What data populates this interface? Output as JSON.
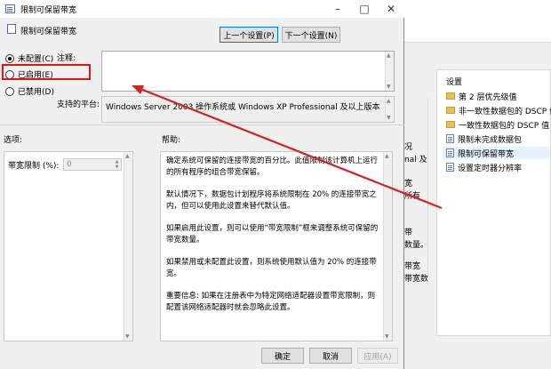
{
  "dialog": {
    "title": "限制可保留带宽",
    "header_label": "限制可保留带宽",
    "prev_button": "上一个设置(P)",
    "next_button": "下一个设置(N)",
    "radio_not_configured": "未配置(C)",
    "radio_enabled": "已启用(E)",
    "radio_disabled": "已禁用(D)",
    "comment_label": "注释:",
    "supported_label": "支持的平台:",
    "supported_value": "Windows Server 2003 操作系统或 Windows XP Professional 及以上版本",
    "options_label": "选项:",
    "help_label": "帮助:",
    "bandwidth_label": "带宽限制 (%):",
    "bandwidth_value": "0",
    "help_paragraphs": [
      "确定系统可保留的连接带宽的百分比。此值限制该计算机上运行的所有程序的组合带宽保留。",
      "默认情况下，数据包计划程序将系统限制在 20% 的连接带宽之内，但可以使用此设置来替代默认值。",
      "如果启用此设置，则可以使用“带宽限制”框来调整系统可保留的带宽数量。",
      "如果禁用或未配置此设置，则系统使用默认值为 20% 的连接带宽。",
      "重要信息: 如果在注册表中为特定网络适配器设置带宽限制，则配置该网络适配器时就会忽略此设置。"
    ],
    "ok_button": "确定",
    "cancel_button": "取消",
    "apply_button": "应用(A)"
  },
  "background": {
    "panel_header": "设置",
    "items": [
      {
        "icon": "folder-icon",
        "label": "第 2 层优先级值"
      },
      {
        "icon": "folder-icon",
        "label": "非一致性数据包的 DSCP 值"
      },
      {
        "icon": "folder-icon",
        "label": "一致性数据包的 DSCP 值"
      },
      {
        "icon": "policy-icon",
        "label": "限制未完成数据包"
      },
      {
        "icon": "policy-icon",
        "label": "限制可保留带宽"
      },
      {
        "icon": "policy-icon",
        "label": "设置定时器分辨率"
      }
    ],
    "left_fragments": [
      "况",
      "nal 及",
      "宽",
      "所有",
      "带",
      "数量。",
      "带宽",
      "带宽数"
    ]
  },
  "colors": {
    "highlight": "#e0131b",
    "arrow": "#d42027"
  }
}
